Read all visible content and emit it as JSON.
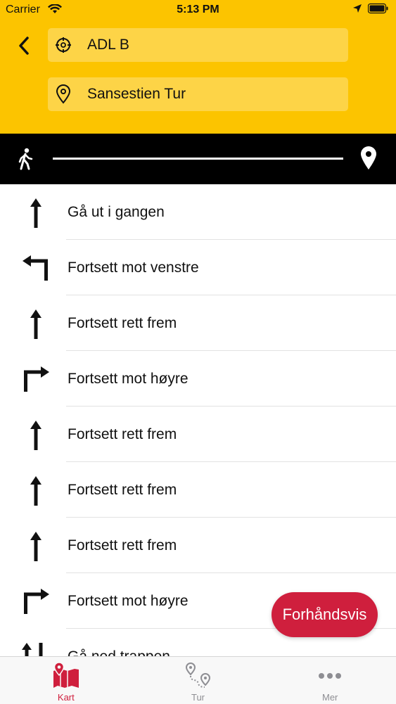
{
  "status_bar": {
    "carrier": "Carrier",
    "time": "5:13 PM"
  },
  "header": {
    "from_field": {
      "value": "ADL B",
      "icon": "crosshair-icon"
    },
    "to_field": {
      "value": "Sansestien Tur",
      "icon": "location-pin-icon"
    }
  },
  "steps": [
    {
      "label": "Gå ut i gangen",
      "icon": "arrow-up-icon"
    },
    {
      "label": "Fortsett mot venstre",
      "icon": "turn-left-icon"
    },
    {
      "label": "Fortsett rett frem",
      "icon": "arrow-up-icon"
    },
    {
      "label": "Fortsett mot høyre",
      "icon": "turn-right-icon"
    },
    {
      "label": "Fortsett rett frem",
      "icon": "arrow-up-icon"
    },
    {
      "label": "Fortsett rett frem",
      "icon": "arrow-up-icon"
    },
    {
      "label": "Fortsett rett frem",
      "icon": "arrow-up-icon"
    },
    {
      "label": "Fortsett mot høyre",
      "icon": "turn-right-icon"
    },
    {
      "label": "Gå ned trappen",
      "icon": "stairs-down-icon"
    }
  ],
  "preview_button": {
    "label": "Forhåndsvis"
  },
  "tabs": [
    {
      "label": "Kart",
      "icon": "map-icon",
      "active": true
    },
    {
      "label": "Tur",
      "icon": "route-icon",
      "active": false
    },
    {
      "label": "Mer",
      "icon": "more-dots-icon",
      "active": false
    }
  ],
  "colors": {
    "header": "#fcc400",
    "accent": "#cf1f3d",
    "inactive_tab": "#8e8e93"
  }
}
